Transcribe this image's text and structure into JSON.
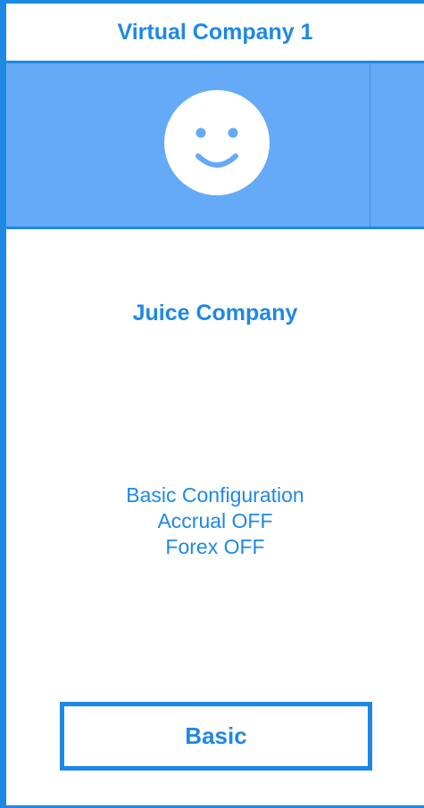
{
  "header": {
    "title": "Virtual Company 1"
  },
  "banner": {
    "background_color": "#64aaf6",
    "avatar_icon": "smiley-face-icon"
  },
  "company": {
    "name": "Juice Company"
  },
  "configuration": {
    "lines": [
      "Basic Configuration",
      "Accrual OFF",
      "Forex OFF"
    ]
  },
  "action": {
    "button_label": "Basic"
  },
  "colors": {
    "accent": "#1e88e5",
    "banner": "#64aaf6",
    "background": "#ffffff"
  }
}
